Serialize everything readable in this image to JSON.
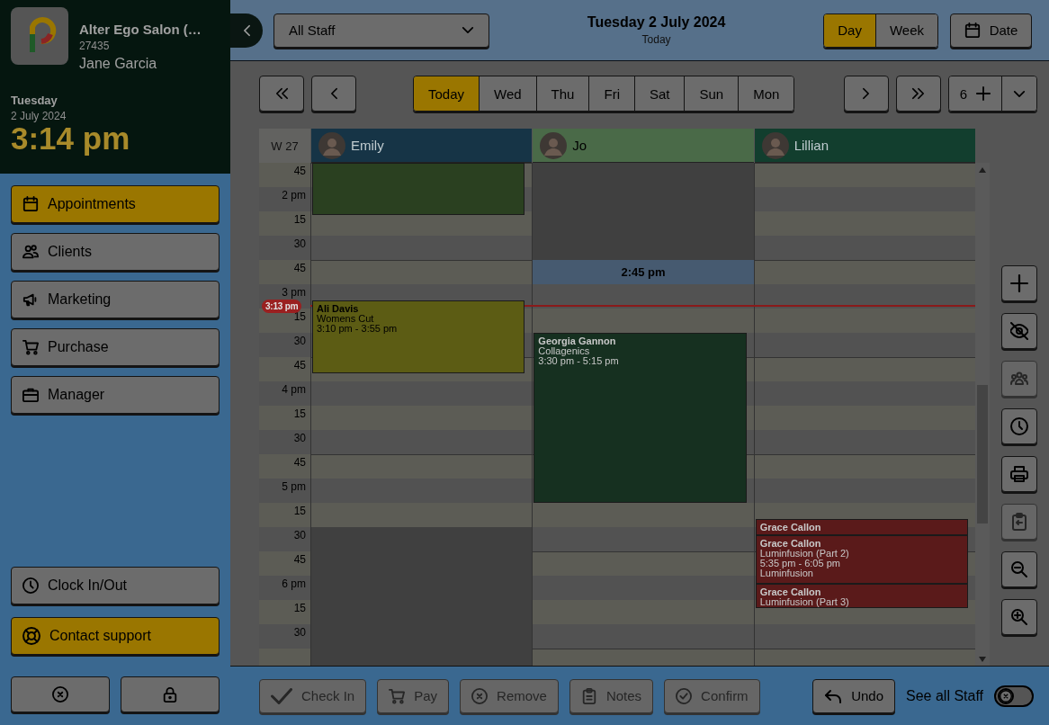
{
  "sidebar": {
    "business_name": "Alter Ego Salon (…",
    "business_id": "27435",
    "user_name": "Jane Garcia",
    "day": "Tuesday",
    "date": "2 July 2024",
    "time": "3:14 pm",
    "nav": [
      {
        "label": "Appointments",
        "kind": "calendar",
        "selected": true
      },
      {
        "label": "Clients",
        "kind": "people",
        "selected": false
      },
      {
        "label": "Marketing",
        "kind": "megaphone",
        "selected": false
      },
      {
        "label": "Purchase",
        "kind": "cart",
        "selected": false
      },
      {
        "label": "Manager",
        "kind": "briefcase",
        "selected": false
      }
    ],
    "clock_button": {
      "label": "Clock In/Out"
    },
    "support_button": {
      "label": "Contact support"
    },
    "footer_buttons": [
      {
        "kind": "close"
      },
      {
        "kind": "lock"
      }
    ]
  },
  "top_bar": {
    "staff_select": {
      "value": "All Staff"
    },
    "title": "Tuesday 2 July 2024",
    "subtitle": "Today",
    "view_toggle": [
      {
        "label": "Day",
        "selected": true
      },
      {
        "label": "Week",
        "selected": false
      }
    ],
    "date_button": {
      "label": "Date"
    }
  },
  "navigation": {
    "day_tabs": [
      {
        "label": "Today",
        "selected": true
      },
      {
        "label": "Wed",
        "selected": false
      },
      {
        "label": "Thu",
        "selected": false
      },
      {
        "label": "Fri",
        "selected": false
      },
      {
        "label": "Sat",
        "selected": false
      },
      {
        "label": "Sun",
        "selected": false
      },
      {
        "label": "Mon",
        "selected": false
      }
    ],
    "staff_count": "6"
  },
  "calendar": {
    "week_label": "W 27",
    "time_labels": [
      "45",
      "2 pm",
      "15",
      "30",
      "45",
      "3 pm",
      "15",
      "30",
      "45",
      "4 pm",
      "15",
      "30",
      "45",
      "5 pm",
      "15",
      "30",
      "45",
      "6 pm",
      "15",
      "30"
    ],
    "now_label": "3:13 pm",
    "staff": [
      {
        "name": "Emily",
        "color": "#163446",
        "events": [
          {
            "kind": "appointment",
            "color": "#2a4020"
          },
          {
            "kind": "appointment",
            "color": "#5c5c14",
            "lines": [
              "Ali Davis",
              "Womens Cut",
              "3:10 pm - 3:55 pm"
            ]
          },
          {
            "kind": "blocked",
            "color": "#404040"
          }
        ]
      },
      {
        "name": "Jo",
        "color": "#4a6a48",
        "events": [
          {
            "kind": "blocked",
            "color": "#404040"
          },
          {
            "kind": "slot",
            "color": "#465a70",
            "lines": [
              "2:45 pm"
            ]
          },
          {
            "kind": "appointment",
            "color": "#163020",
            "lines": [
              "Georgia Gannon",
              "Collagenics",
              "3:30 pm - 5:15 pm"
            ]
          }
        ]
      },
      {
        "name": "Lillian",
        "color": "#123e2e",
        "events": [
          {
            "kind": "appointment",
            "color": "#5a1a1a",
            "lines": [
              "Grace Callon"
            ]
          },
          {
            "kind": "appointment",
            "color": "#5a1a1a",
            "lines": [
              "Grace Callon",
              "Luminfusion (Part 2)",
              "5:35 pm - 6:05 pm",
              "Luminfusion"
            ]
          },
          {
            "kind": "appointment",
            "color": "#5a1a1a",
            "lines": [
              "Grace Callon",
              "Luminfusion (Part 3)"
            ]
          }
        ]
      }
    ]
  },
  "tools": [
    {
      "kind": "add",
      "disabled": false
    },
    {
      "kind": "hide",
      "disabled": false
    },
    {
      "kind": "group",
      "disabled": true
    },
    {
      "kind": "clock",
      "disabled": false
    },
    {
      "kind": "print",
      "disabled": false
    },
    {
      "kind": "clipboard",
      "disabled": true
    },
    {
      "kind": "zoom-out",
      "disabled": false
    },
    {
      "kind": "zoom-in",
      "disabled": false
    }
  ],
  "bottom_bar": {
    "actions": [
      {
        "label": "Check In",
        "kind": "check",
        "disabled": true
      },
      {
        "label": "Pay",
        "kind": "cart",
        "disabled": true
      },
      {
        "label": "Remove",
        "kind": "x-circle",
        "disabled": true
      },
      {
        "label": "Notes",
        "kind": "notes",
        "disabled": true
      },
      {
        "label": "Confirm",
        "kind": "check-circle",
        "disabled": true
      }
    ],
    "undo": {
      "label": "Undo"
    },
    "see_all_staff": {
      "label": "See all Staff",
      "on": false
    }
  }
}
